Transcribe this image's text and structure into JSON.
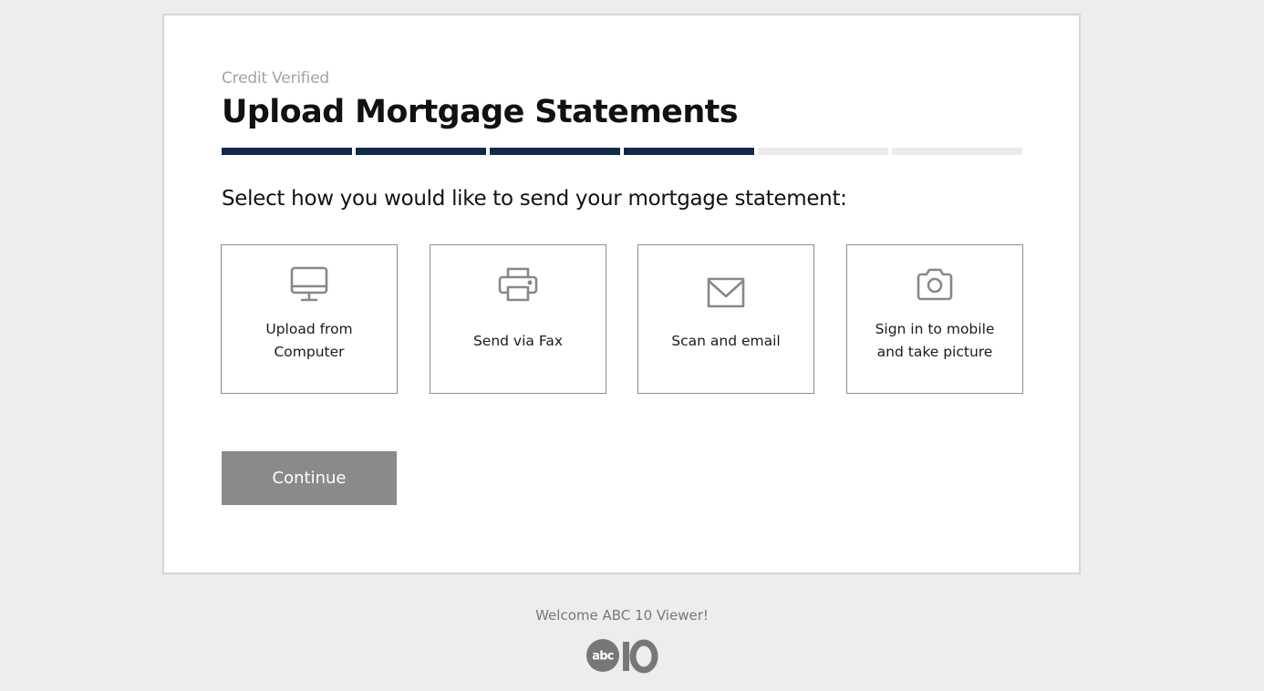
{
  "header": {
    "eyebrow": "Credit Verified",
    "title": "Upload Mortgage Statements"
  },
  "progress": {
    "total_steps": 6,
    "completed_steps": 4,
    "active_color": "#0f2a4b",
    "inactive_color": "#ebebeb"
  },
  "prompt": "Select how you would like to send your mortgage statement:",
  "options": [
    {
      "icon": "desktop-computer-icon",
      "label_line1": "Upload from",
      "label_line2": "Computer"
    },
    {
      "icon": "printer-fax-icon",
      "label": "Send via Fax"
    },
    {
      "icon": "envelope-icon",
      "label": "Scan and email"
    },
    {
      "icon": "camera-icon",
      "label_line1": "Sign in to mobile",
      "label_line2": "and take picture"
    }
  ],
  "actions": {
    "continue_label": "Continue"
  },
  "footer": {
    "welcome": "Welcome ABC 10 Viewer!",
    "logo_text": "abc10"
  },
  "colors": {
    "page_background": "#ededed",
    "card_background": "#ffffff",
    "button_background": "#8a8a8a",
    "icon_color": "#888888"
  }
}
